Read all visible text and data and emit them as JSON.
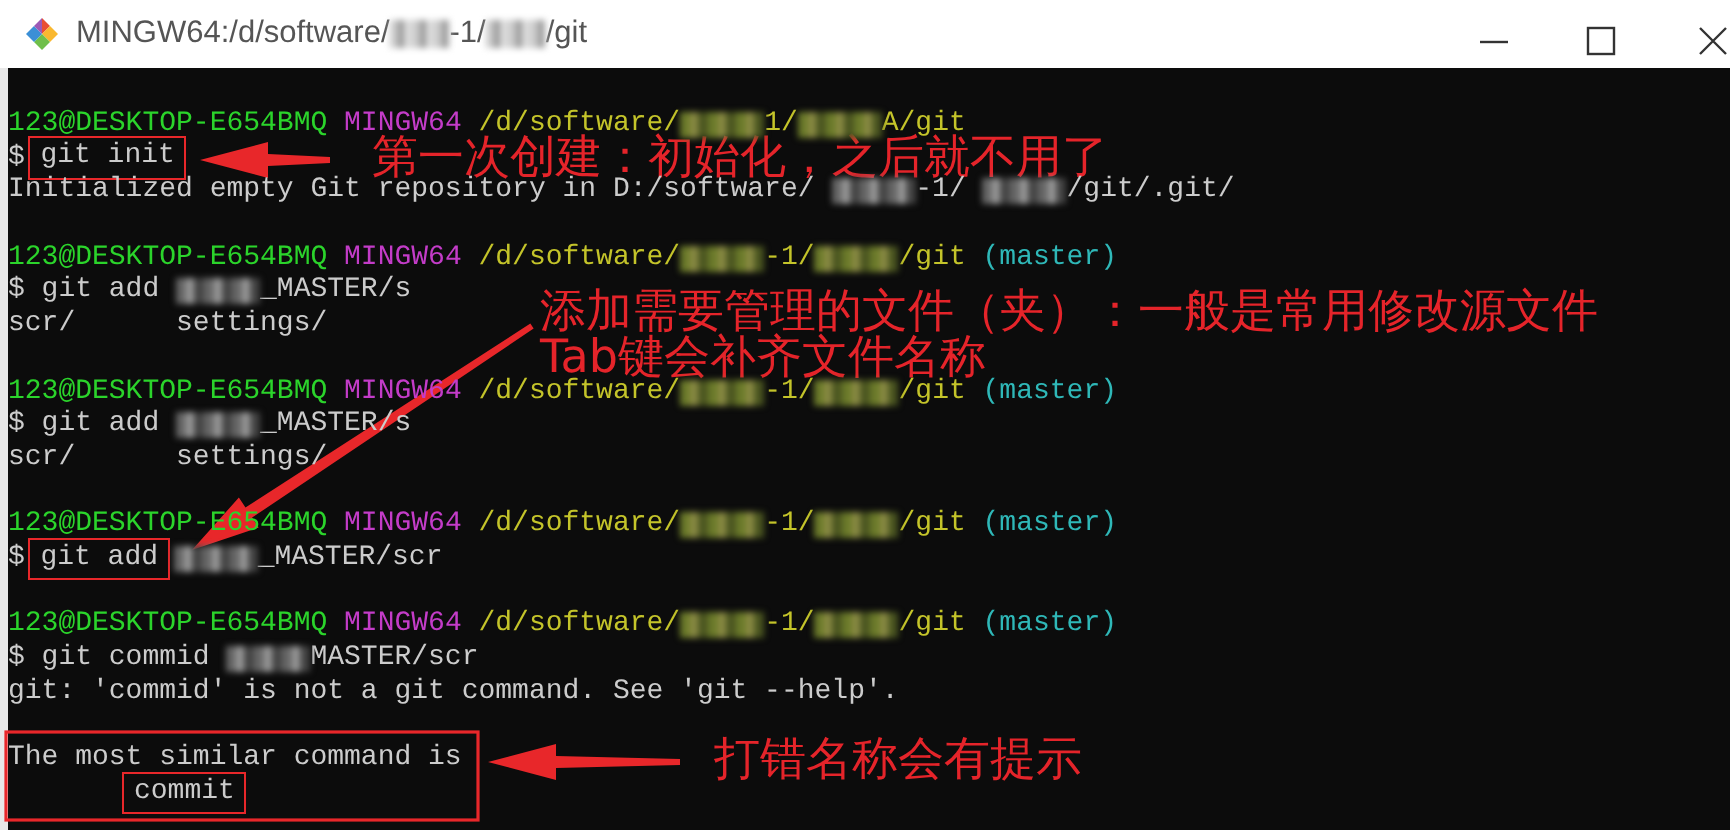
{
  "window": {
    "title": [
      {
        "kind": "text",
        "text": "MINGW64:/d/software/"
      },
      {
        "kind": "redacted"
      },
      {
        "kind": "text",
        "text": "-1/"
      },
      {
        "kind": "redacted"
      },
      {
        "kind": "text",
        "text": "/git"
      }
    ]
  },
  "terminal": {
    "lines": [
      {
        "kind": "output",
        "segments": [
          {
            "kind": "user",
            "text": "123@DESKTOP-E654BMQ"
          },
          {
            "kind": "system",
            "text": "MINGW64"
          },
          {
            "kind": "path",
            "text": "/d/software/"
          },
          {
            "kind": "redacted"
          },
          {
            "kind": "path",
            "text": "1/"
          },
          {
            "kind": "redacted"
          },
          {
            "kind": "path",
            "text": "A/git"
          }
        ]
      },
      {
        "kind": "output",
        "segments": [
          {
            "kind": "plain",
            "text": "$"
          },
          {
            "kind": "plain",
            "text": "git init",
            "boxed": true
          }
        ]
      },
      {
        "kind": "output",
        "segments": [
          {
            "kind": "plain",
            "text": "Initialized empty Git repository in D:/software/"
          },
          {
            "kind": "redacted"
          },
          {
            "kind": "plain",
            "text": "-1/"
          },
          {
            "kind": "redacted"
          },
          {
            "kind": "plain",
            "text": "/git/.git/"
          }
        ]
      },
      {
        "kind": "blank"
      },
      {
        "kind": "output",
        "segments": [
          {
            "kind": "user",
            "text": "123@DESKTOP-E654BMQ"
          },
          {
            "kind": "system",
            "text": "MINGW64"
          },
          {
            "kind": "path",
            "text": "/d/software/"
          },
          {
            "kind": "redacted"
          },
          {
            "kind": "path",
            "text": "-1/"
          },
          {
            "kind": "redacted"
          },
          {
            "kind": "path",
            "text": "/git"
          },
          {
            "kind": "branch",
            "text": "(master)"
          }
        ]
      },
      {
        "kind": "output",
        "segments": [
          {
            "kind": "plain",
            "text": "$ git add"
          },
          {
            "kind": "redacted"
          },
          {
            "kind": "plain",
            "text": "_MASTER/s"
          }
        ]
      },
      {
        "kind": "output",
        "segments": [
          {
            "kind": "plain",
            "text": "scr/      settings/"
          }
        ]
      },
      {
        "kind": "blank"
      },
      {
        "kind": "output",
        "segments": [
          {
            "kind": "user",
            "text": "123@DESKTOP-E654BMQ"
          },
          {
            "kind": "system",
            "text": "MINGW64"
          },
          {
            "kind": "path",
            "text": "/d/software/"
          },
          {
            "kind": "redacted"
          },
          {
            "kind": "path",
            "text": "-1/"
          },
          {
            "kind": "redacted"
          },
          {
            "kind": "path",
            "text": "/git"
          },
          {
            "kind": "branch",
            "text": "(master)"
          }
        ]
      },
      {
        "kind": "output",
        "segments": [
          {
            "kind": "plain",
            "text": "$ git add"
          },
          {
            "kind": "redacted"
          },
          {
            "kind": "plain",
            "text": "_MASTER/s"
          }
        ]
      },
      {
        "kind": "output",
        "segments": [
          {
            "kind": "plain",
            "text": "scr/      settings/"
          }
        ]
      },
      {
        "kind": "blank"
      },
      {
        "kind": "output",
        "segments": [
          {
            "kind": "user",
            "text": "123@DESKTOP-E654BMQ"
          },
          {
            "kind": "system",
            "text": "MINGW64"
          },
          {
            "kind": "path",
            "text": "/d/software/"
          },
          {
            "kind": "redacted"
          },
          {
            "kind": "path",
            "text": "-1/"
          },
          {
            "kind": "redacted"
          },
          {
            "kind": "path",
            "text": "/git"
          },
          {
            "kind": "branch",
            "text": "(master)"
          }
        ]
      },
      {
        "kind": "output",
        "segments": [
          {
            "kind": "plain",
            "text": "$"
          },
          {
            "kind": "plain",
            "text": "git add",
            "boxed": true
          },
          {
            "kind": "redacted"
          },
          {
            "kind": "plain",
            "text": "_MASTER/scr"
          }
        ]
      },
      {
        "kind": "blank"
      },
      {
        "kind": "output",
        "segments": [
          {
            "kind": "user",
            "text": "123@DESKTOP-E654BMQ"
          },
          {
            "kind": "system",
            "text": "MINGW64"
          },
          {
            "kind": "path",
            "text": "/d/software/"
          },
          {
            "kind": "redacted"
          },
          {
            "kind": "path",
            "text": "-1/"
          },
          {
            "kind": "redacted"
          },
          {
            "kind": "path",
            "text": "/git"
          },
          {
            "kind": "branch",
            "text": "(master)"
          }
        ]
      },
      {
        "kind": "output",
        "segments": [
          {
            "kind": "plain",
            "text": "$ git commid"
          },
          {
            "kind": "redacted"
          },
          {
            "kind": "plain",
            "text": "MASTER/scr"
          }
        ]
      },
      {
        "kind": "output",
        "segments": [
          {
            "kind": "plain",
            "text": "git: 'commid' is not a git command. See 'git --help'."
          }
        ]
      },
      {
        "kind": "blank"
      },
      {
        "kind": "output",
        "segments": [
          {
            "kind": "plain",
            "text": "The most similar command is"
          }
        ]
      },
      {
        "kind": "output",
        "segments": [
          {
            "kind": "indent"
          },
          {
            "kind": "plain",
            "text": "commit",
            "boxed": true
          }
        ]
      }
    ]
  },
  "annotations": [
    {
      "lines": [
        "第一次创建：初始化，之后就不用了"
      ]
    },
    {
      "lines": [
        "添加需要管理的文件（夹）：一般是常用修改源文件",
        "Tab键会补齐文件名称"
      ]
    },
    {
      "lines": [
        "打错名称会有提示"
      ]
    }
  ]
}
